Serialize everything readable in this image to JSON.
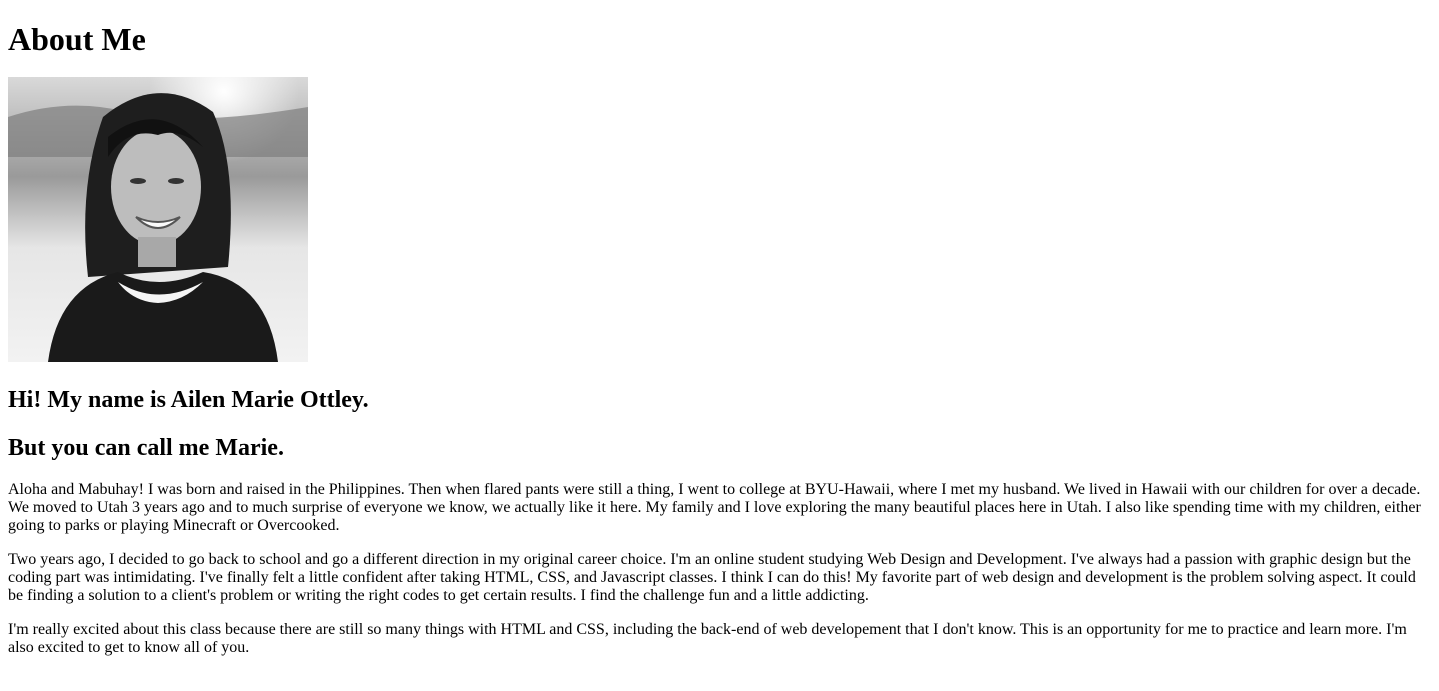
{
  "page": {
    "title": "About Me",
    "greeting": "Hi! My name is Ailen Marie Ottley.",
    "nickname": "But you can call me Marie.",
    "paragraphs": [
      "Aloha and Mabuhay! I was born and raised in the Philippines. Then when flared pants were still a thing, I went to college at BYU-Hawaii, where I met my husband. We lived in Hawaii with our children for over a decade. We moved to Utah 3 years ago and to much surprise of everyone we know, we actually like it here. My family and I love exploring the many beautiful places here in Utah. I also like spending time with my children, either going to parks or playing Minecraft or Overcooked.",
      "Two years ago, I decided to go back to school and go a different direction in my original career choice. I'm an online student studying Web Design and Development. I've always had a passion with graphic design but the coding part was intimidating. I've finally felt a little confident after taking HTML, CSS, and Javascript classes. I think I can do this! My favorite part of web design and development is the problem solving aspect. It could be finding a solution to a client's problem or writing the right codes to get certain results. I find the challenge fun and a little addicting.",
      "I'm really excited about this class because there are still so many things with HTML and CSS, including the back-end of web developement that I don't know. This is an opportunity for me to practice and learn more. I'm also excited to get to know all of you."
    ]
  }
}
